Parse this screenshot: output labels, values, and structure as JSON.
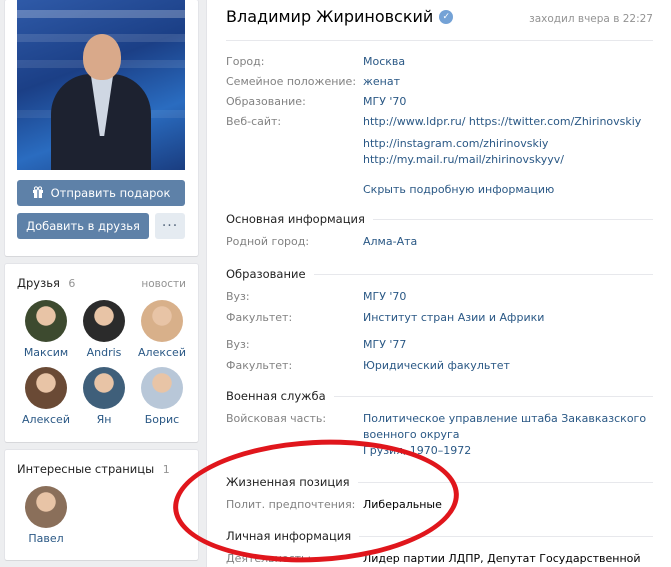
{
  "left": {
    "gift_button": "Отправить подарок",
    "add_friend_button": "Добавить в друзья",
    "more_button": "···",
    "friends": {
      "title": "Друзья",
      "count": "6",
      "link": "новости",
      "items": [
        {
          "name": "Максим",
          "color": "#3d4a2f"
        },
        {
          "name": "Andris",
          "color": "#2b2b2b"
        },
        {
          "name": "Алексей",
          "color": "#d8b08a"
        },
        {
          "name": "Алексей",
          "color": "#6a4a35"
        },
        {
          "name": "Ян",
          "color": "#3f5f7a"
        },
        {
          "name": "Борис",
          "color": "#b8c7d8"
        }
      ]
    },
    "pages": {
      "title": "Интересные страницы",
      "count": "1",
      "items": [
        {
          "name": "Павел",
          "color": "#8a6f5a"
        }
      ]
    }
  },
  "profile": {
    "name": "Владимир Жириновский",
    "last_seen": "заходил вчера в 22:27",
    "rows_top": [
      {
        "label": "Город:",
        "value": "Москва"
      },
      {
        "label": "Семейное положение:",
        "value": "женат"
      },
      {
        "label": "Образование:",
        "value": "МГУ '70"
      },
      {
        "label": "Веб-сайт:",
        "value": "http://www.ldpr.ru/ https://twitter.com/Zhirinovskiy"
      }
    ],
    "website_more": [
      "http://instagram.com/zhirinovskiy",
      "http://my.mail.ru/mail/zhirinovskyyv/"
    ],
    "hide_link": "Скрыть подробную информацию",
    "sections": {
      "main_info": "Основная информация",
      "hometown_label": "Родной город:",
      "hometown_value": "Алма-Ата",
      "education": "Образование",
      "uni1_label": "Вуз:",
      "uni1_value": "МГУ '70",
      "fac1_label": "Факультет:",
      "fac1_value": "Институт стран Азии и Африки",
      "uni2_label": "Вуз:",
      "uni2_value": "МГУ '77",
      "fac2_label": "Факультет:",
      "fac2_value": "Юридический факультет",
      "military": "Военная служба",
      "unit_label": "Войсковая часть:",
      "unit_value_1": "Политическое управление штаба Закавказского",
      "unit_value_2": "военного округа",
      "unit_value_3": "Грузия, 1970–1972",
      "life_position": "Жизненная позиция",
      "politics_label": "Полит. предпочтения:",
      "politics_value": "Либеральные",
      "personal": "Личная информация",
      "activity_label": "Деятельность:",
      "activity_value": "Лидер партии ЛДПР, Депутат Государственной Думы"
    }
  },
  "colors": {
    "link": "#2a5885",
    "label": "#828282",
    "button": "#5e81a8",
    "annotation": "#e0161c"
  }
}
